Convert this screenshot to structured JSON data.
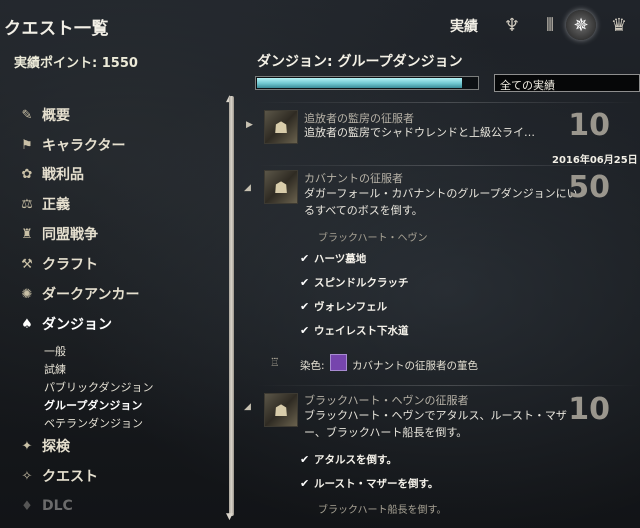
{
  "header": {
    "title": "クエスト一覧",
    "section_title": "実績",
    "icons": [
      {
        "name": "wings-icon",
        "glyph": "♆"
      },
      {
        "name": "bars-icon",
        "glyph": "⫴"
      },
      {
        "name": "star-emblem-icon",
        "glyph": "✵",
        "active": true
      },
      {
        "name": "trophy-icon",
        "glyph": "🏆"
      }
    ]
  },
  "points": {
    "label": "実績ポイント: 1550"
  },
  "category_title": "ダンジョン: グループダンジョン",
  "progress": {
    "fraction": 0.93,
    "fill_color": "#7fd3da"
  },
  "filter": {
    "value": "全ての実績"
  },
  "sidebar": {
    "categories": [
      {
        "label": "概要",
        "icon": "scroll-icon",
        "glyph": "✎"
      },
      {
        "label": "キャラクター",
        "icon": "banner-icon",
        "glyph": "⚑"
      },
      {
        "label": "戦利品",
        "icon": "loot-icon",
        "glyph": "✿"
      },
      {
        "label": "正義",
        "icon": "justice-icon",
        "glyph": "⚖"
      },
      {
        "label": "同盟戦争",
        "icon": "alliance-war-icon",
        "glyph": "♜"
      },
      {
        "label": "クラフト",
        "icon": "craft-icon",
        "glyph": "⚒"
      },
      {
        "label": "ダークアンカー",
        "icon": "dark-anchor-icon",
        "glyph": "✺"
      },
      {
        "label": "ダンジョン",
        "icon": "dungeon-icon",
        "glyph": "♠",
        "active": true
      },
      {
        "label": "探検",
        "icon": "explore-icon",
        "glyph": "✦"
      },
      {
        "label": "クエスト",
        "icon": "quest-icon",
        "glyph": "✧"
      },
      {
        "label": "DLC",
        "icon": "dlc-icon",
        "glyph": "♦",
        "dim": true
      }
    ],
    "subcategories": [
      {
        "label": "一般"
      },
      {
        "label": "試練"
      },
      {
        "label": "パブリックダンジョン"
      },
      {
        "label": "グループダンジョン",
        "active": true
      },
      {
        "label": "ベテランダンジョン"
      }
    ]
  },
  "entries": [
    {
      "name": "追放者の監房の征服者",
      "desc": "追放者の監房でシャドウレンドと上級公ライ…",
      "points": "10",
      "date": "2016年06月25日",
      "expanded": false
    },
    {
      "name": "カバナントの征服者",
      "desc_line1": "ダガーフォール・カバナントのグループダンジョンにい",
      "desc_line2": "るすべてのボスを倒す。",
      "points": "50",
      "group_label": "ブラックハート・ヘヴン",
      "tasks": [
        "ハーツ墓地",
        "スピンドルクラッチ",
        "ヴォレンフェル",
        "ウェイレスト下水道"
      ],
      "reward_label": "染色:",
      "reward_name": "カバナントの征服者の菫色",
      "reward_color": "#7645ad",
      "expanded": true
    },
    {
      "name": "ブラックハート・ヘヴンの征服者",
      "desc_line1": "ブラックハート・ヘヴンでアタルス、ルースト・マザ",
      "desc_line2": "ー、ブラックハート船長を倒す。",
      "points": "10",
      "tasks": [
        "アタルスを倒す。",
        "ルースト・マザーを倒す。"
      ],
      "trailing_label": "ブラックハート船長を倒す。",
      "expanded": true
    }
  ]
}
